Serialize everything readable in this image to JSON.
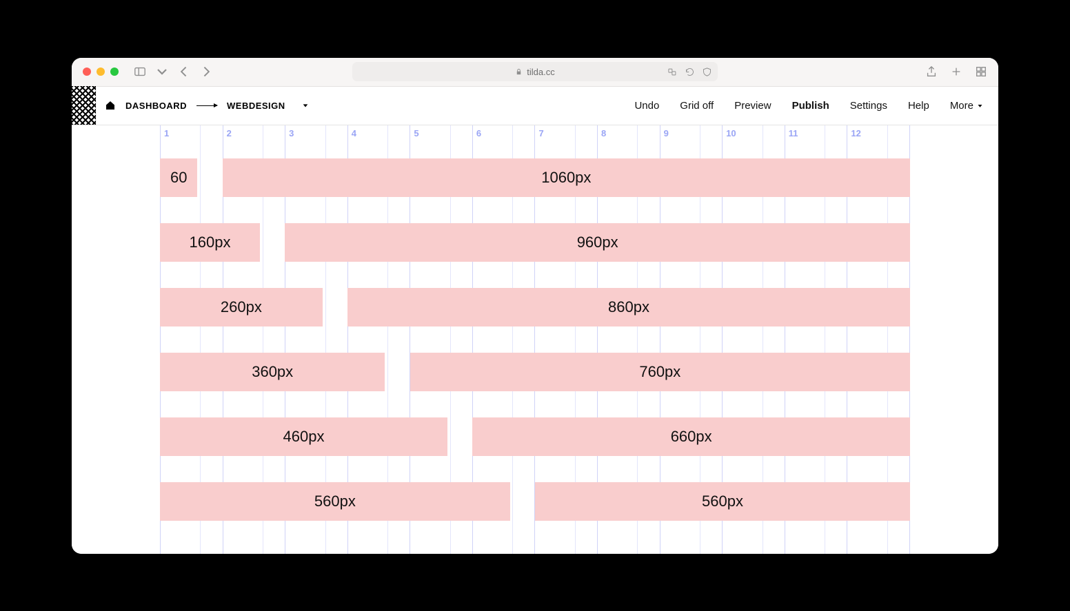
{
  "browser": {
    "url_host": "tilda.cc"
  },
  "breadcrumb": {
    "root": "DASHBOARD",
    "page": "WEBDESIGN"
  },
  "actions": {
    "undo": "Undo",
    "grid": "Grid off",
    "preview": "Preview",
    "publish": "Publish",
    "settings": "Settings",
    "help": "Help",
    "more": "More"
  },
  "grid": {
    "columns": [
      "1",
      "2",
      "3",
      "4",
      "5",
      "6",
      "7",
      "8",
      "9",
      "10",
      "11",
      "12"
    ],
    "total_columns": 12,
    "gap_columns": 0.4,
    "rows": [
      {
        "left_cols": 0.6,
        "left_label": "60",
        "right_label": "1060px"
      },
      {
        "left_cols": 1.6,
        "left_label": "160px",
        "right_label": "960px"
      },
      {
        "left_cols": 2.6,
        "left_label": "260px",
        "right_label": "860px"
      },
      {
        "left_cols": 3.6,
        "left_label": "360px",
        "right_label": "760px"
      },
      {
        "left_cols": 4.6,
        "left_label": "460px",
        "right_label": "660px"
      },
      {
        "left_cols": 5.6,
        "left_label": "560px",
        "right_label": "560px"
      }
    ]
  }
}
